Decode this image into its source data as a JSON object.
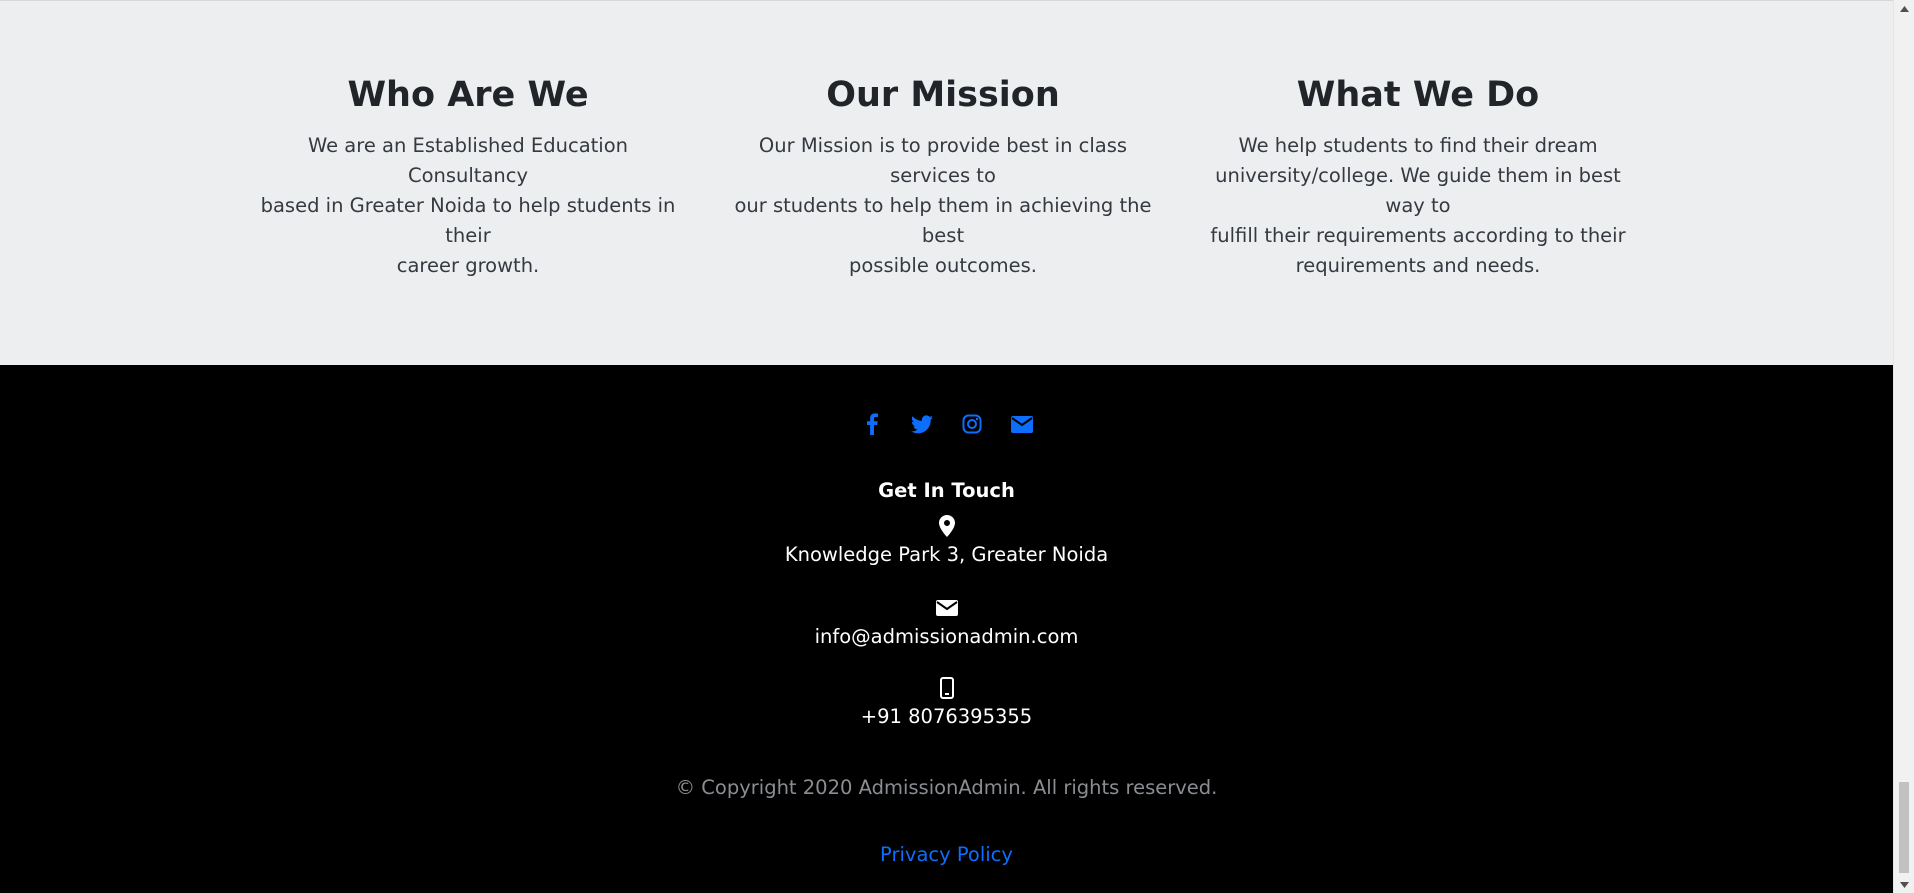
{
  "about": {
    "columns": [
      {
        "title": "Who Are We",
        "lines": [
          "We are an Established Education Consultancy",
          "based in Greater Noida to help students in their",
          "career growth."
        ]
      },
      {
        "title": "Our Mission",
        "lines": [
          "Our Mission is to provide best in class services to",
          "our students to help them in achieving the best",
          "possible outcomes."
        ]
      },
      {
        "title": "What We Do",
        "lines": [
          "We help students to find their dream",
          "university/college. We guide them in best way to",
          "fulfill their requirements according to their",
          "requirements and needs."
        ]
      }
    ]
  },
  "footer": {
    "social": [
      {
        "name": "facebook-icon"
      },
      {
        "name": "twitter-icon"
      },
      {
        "name": "instagram-icon"
      },
      {
        "name": "envelope-icon"
      }
    ],
    "social_color": "#0d6efd",
    "touch_title": "Get In Touch",
    "address": "Knowledge Park 3, Greater Noida",
    "email": "info@admissionadmin.com",
    "phone": "+91 8076395355",
    "copyright": "© Copyright 2020 AdmissionAdmin. All rights reserved.",
    "privacy_label": "Privacy Policy",
    "link_color": "#0d6efd"
  }
}
